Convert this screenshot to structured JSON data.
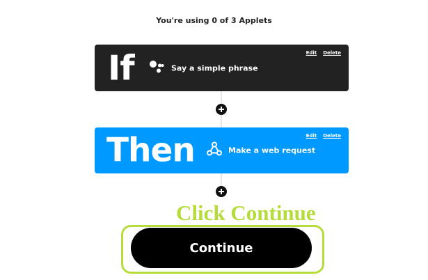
{
  "header": {
    "usage_text": "You're using 0 of 3 Applets"
  },
  "trigger": {
    "keyword": "If",
    "service_icon": "google-assistant-icon",
    "label": "Say a simple phrase",
    "edit_label": "Edit",
    "delete_label": "Delete",
    "color": "#222222"
  },
  "action": {
    "keyword": "Then",
    "service_icon": "webhooks-icon",
    "label": "Make a web request",
    "edit_label": "Edit",
    "delete_label": "Delete",
    "color": "#0099ff"
  },
  "add_icon": "plus-circle-icon",
  "annotation": {
    "text": "Click Continue",
    "color": "#b6dc3c"
  },
  "footer": {
    "continue_label": "Continue"
  }
}
